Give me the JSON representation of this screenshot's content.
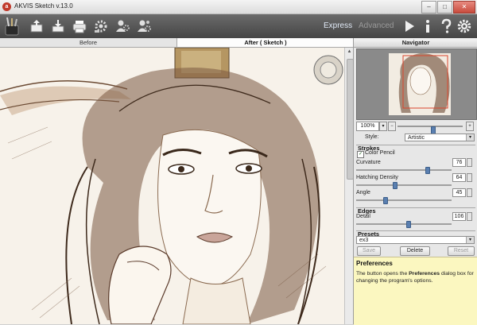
{
  "window": {
    "title": "AKVIS Sketch v.13.0",
    "minimize_glyph": "–",
    "maximize_glyph": "□",
    "close_glyph": "✕"
  },
  "toolbar": {
    "icons": [
      "brush-icon",
      "open-icon",
      "save-icon",
      "print-icon",
      "batch-settings-icon",
      "plugin-settings-icon",
      "plugin-settings-2-icon"
    ],
    "modes": {
      "express": "Express",
      "advanced": "Advanced"
    },
    "right_icons": [
      "run-icon",
      "info-icon",
      "help-icon",
      "preferences-icon"
    ],
    "active_mode_color": "#dfe8f5",
    "inactive_mode_color": "#9a9a9a"
  },
  "tabs": {
    "before": "Before",
    "after": "After ( Sketch )"
  },
  "navigator": {
    "title": "Navigator",
    "zoom": "100%",
    "zoom_slider_level": 0.55,
    "frame_color": "#d9452d"
  },
  "settings": {
    "style_label": "Style:",
    "style_value": "Artistic",
    "strokes_title": "Strokes",
    "color_pencil_label": "Color Pencil",
    "color_pencil_checked": true,
    "curvature_label": "Curvature",
    "curvature_value": "76",
    "curvature_level": 0.76,
    "hatching_label": "Hatching Density",
    "hatching_value": "64",
    "hatching_level": 0.4,
    "angle_label": "Angle",
    "angle_value": "45",
    "angle_level": 0.3,
    "edges_title": "Edges",
    "detail_label": "Detail",
    "detail_value": "106",
    "detail_level": 0.55
  },
  "presets": {
    "title": "Presets",
    "value": "ex3",
    "save_label": "Save",
    "delete_label": "Delete",
    "reset_label": "Reset"
  },
  "help": {
    "title": "Preferences",
    "text_before": "The button opens the ",
    "text_bold": "Preferences",
    "text_after": " dialog box for changing the program's options."
  }
}
